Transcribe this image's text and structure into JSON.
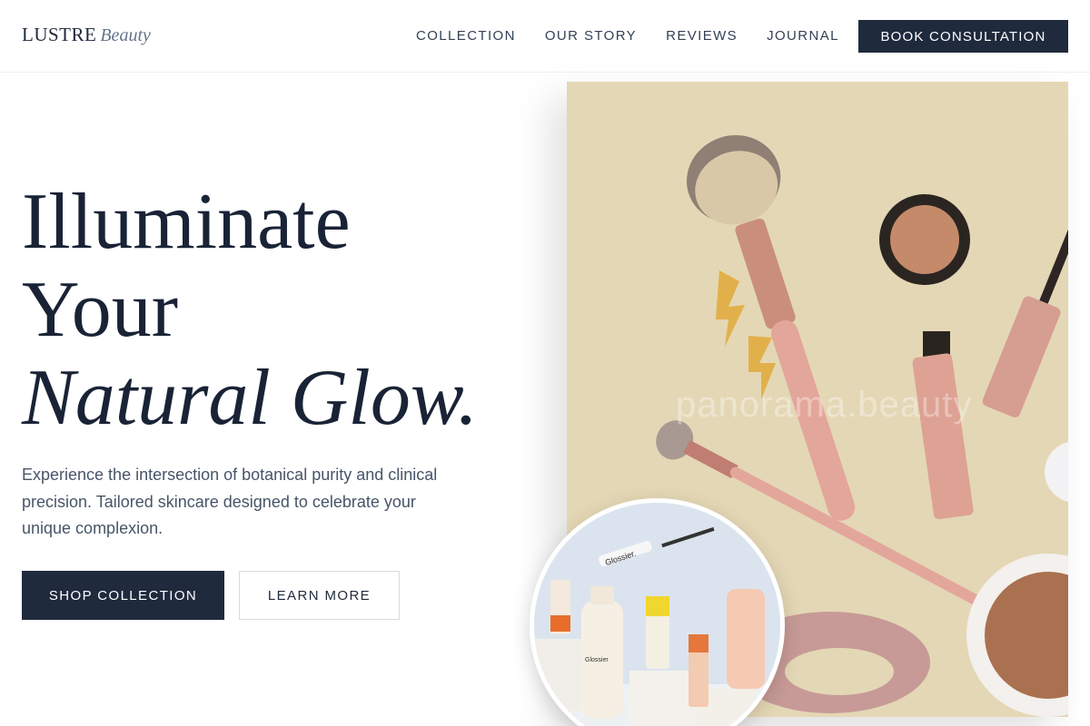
{
  "header": {
    "logo_main": "LUSTRE",
    "logo_sub": "Beauty",
    "nav": [
      "COLLECTION",
      "OUR STORY",
      "REVIEWS",
      "JOURNAL"
    ],
    "cta": "BOOK CONSULTATION"
  },
  "hero": {
    "title_line1": "Illuminate",
    "title_line2": "Your",
    "title_line3": "Natural Glow.",
    "description": "Experience the intersection of botanical purity and clinical precision. Tailored skincare designed to celebrate your unique complexion.",
    "primary_button": "SHOP COLLECTION",
    "secondary_button": "LEARN MORE"
  },
  "images": {
    "main_watermark": "panorama.beauty",
    "circle_label_1": "Glossier.",
    "circle_label_2": "Glossier"
  },
  "colors": {
    "accent": "#1f2a3d",
    "main_bg": "#e4d7b5"
  }
}
